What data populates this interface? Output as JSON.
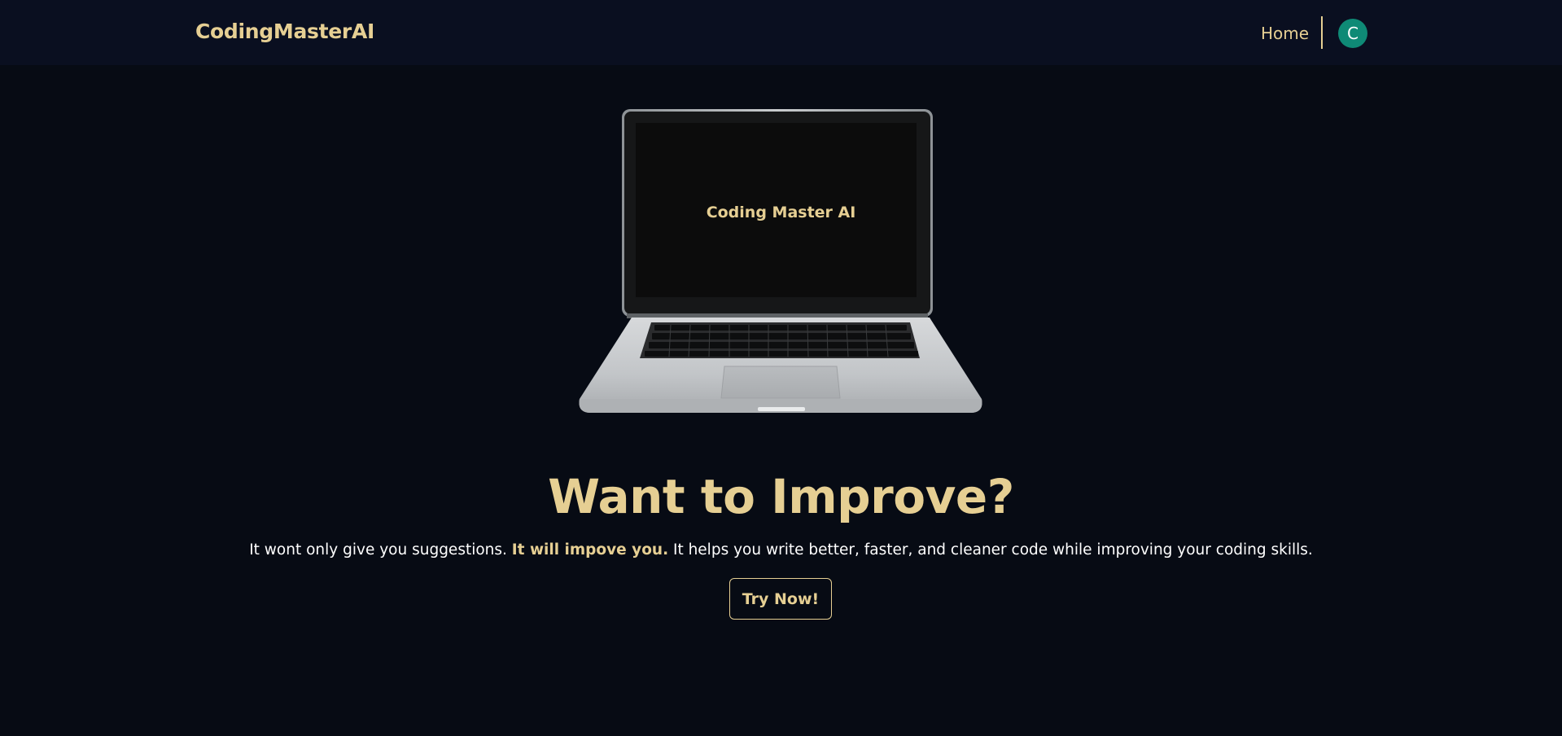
{
  "header": {
    "brand": "CodingMasterAI",
    "nav_home": "Home",
    "avatar_initial": "C"
  },
  "hero": {
    "screen_text": "Coding Master AI",
    "headline": "Want to Improve?",
    "subtitle_part1": "It wont only give you suggestions. ",
    "subtitle_highlight": "It will impove you.",
    "subtitle_part2": " It helps you write better, faster, and cleaner code while improving your coding skills.",
    "cta_label": "Try Now!"
  },
  "colors": {
    "background": "#070b14",
    "navbar": "#0a0f20",
    "accent_gold": "#e6cf93",
    "avatar": "#0f8a76"
  }
}
